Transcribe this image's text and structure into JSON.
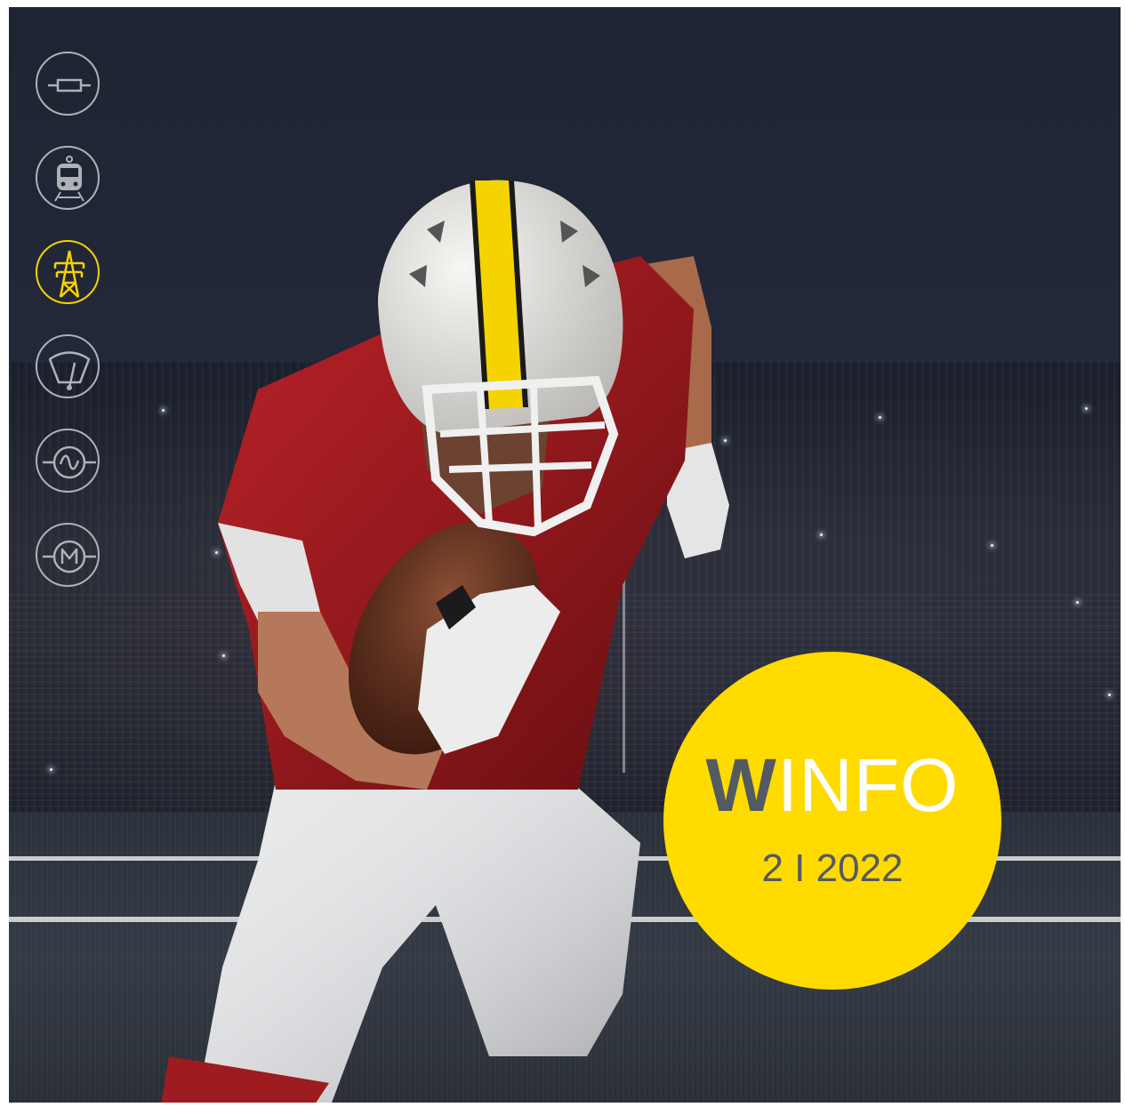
{
  "badge": {
    "brand_initial": "W",
    "brand_rest": "INFO",
    "issue": "2 I 2022"
  },
  "icons": [
    {
      "name": "fuse-icon",
      "active": false
    },
    {
      "name": "train-icon",
      "active": false
    },
    {
      "name": "power-pylon-icon",
      "active": true
    },
    {
      "name": "gauge-icon",
      "active": false
    },
    {
      "name": "ac-wave-icon",
      "active": false
    },
    {
      "name": "motor-icon",
      "active": false
    }
  ],
  "colors": {
    "accent": "#ffdb00",
    "icon_inactive": "#aeb2b8",
    "brand_dark": "#535a62",
    "background": "#1e2431"
  }
}
